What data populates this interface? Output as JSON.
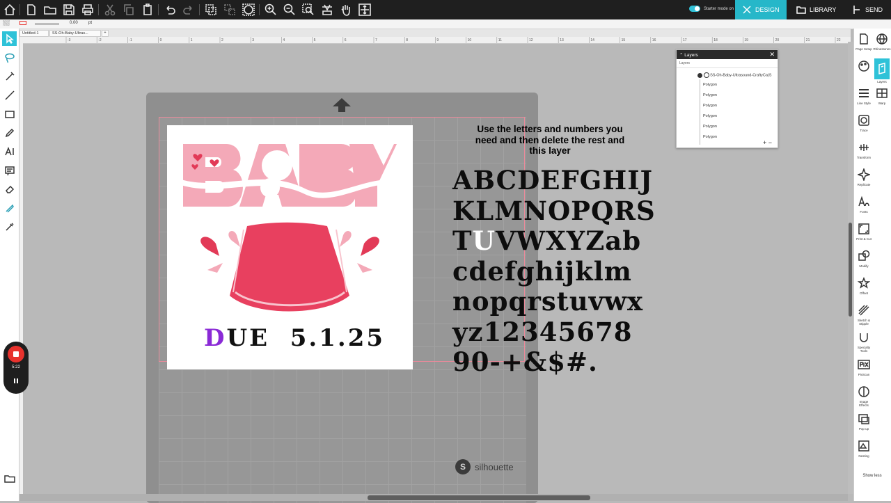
{
  "topbar": {
    "starter_mode": "Starter mode on",
    "design": "DESIGN",
    "library": "LIBRARY",
    "send": "SEND"
  },
  "subbar": {
    "line_value": "0.00",
    "unit": "pt"
  },
  "tabs": [
    {
      "label": "Untitled-1"
    },
    {
      "label": "SS-Oh-Baby-Ultras..."
    }
  ],
  "ruler": {
    "labels": [
      "-3",
      "-2",
      "-1",
      "0",
      "1",
      "2",
      "3",
      "4",
      "5",
      "6",
      "7",
      "8",
      "9",
      "10",
      "11",
      "12",
      "13",
      "14",
      "15",
      "16",
      "17",
      "18",
      "19",
      "20",
      "21",
      "22"
    ]
  },
  "recorder": {
    "time": "5:22"
  },
  "design": {
    "title_word": "BABY",
    "due_prefix": "D",
    "due_rest": "UE  5.1.25"
  },
  "instructions": "Use the letters and numbers you need and then delete the rest and this layer",
  "alphabet": {
    "row1": "ABCDEFGHIJ",
    "row2": "KLMNOPQRS",
    "row3_a": "T",
    "row3_b": "U",
    "row3_c": "VWXYZab",
    "row4": "cdefghijklm",
    "row5": "nopqrstuvwx",
    "row6": "yz12345678",
    "row7": "90-+&$#."
  },
  "mat": {
    "brand": "silhouette"
  },
  "layers_panel": {
    "title": "Layers",
    "subtitle": "Layers",
    "group": "SS-Oh-Baby-Ultrasound-CraftyCa(S",
    "items": [
      "Polygon",
      "Polygon",
      "Polygon",
      "Polygon",
      "Polygon",
      "Polygon"
    ]
  },
  "right_panel": {
    "items": [
      {
        "label": "Page Setup"
      },
      {
        "label": "Rhinestones"
      },
      {
        "label": ""
      },
      {
        "label": "Layers"
      },
      {
        "label": "Line Style"
      },
      {
        "label": "Warp"
      },
      {
        "label": "Trace"
      },
      {
        "label": "Transform"
      },
      {
        "label": "Replicate"
      },
      {
        "label": "Fonts"
      },
      {
        "label": "Print & Cut"
      },
      {
        "label": "Modify"
      },
      {
        "label": "Offset"
      },
      {
        "label": "Sketch & Stipple"
      },
      {
        "label": "Specialty Tools"
      },
      {
        "label": "PixScan"
      },
      {
        "label": "Image Effects"
      },
      {
        "label": "Pop up"
      },
      {
        "label": "Nesting"
      },
      {
        "label": "Show less"
      }
    ]
  },
  "colors": {
    "accent": "#26b7c9",
    "pink_light": "#f4a9b8",
    "pink_dark": "#e8405f",
    "heart_red": "#e23a57",
    "due_highlight": "#8a2ad6"
  }
}
